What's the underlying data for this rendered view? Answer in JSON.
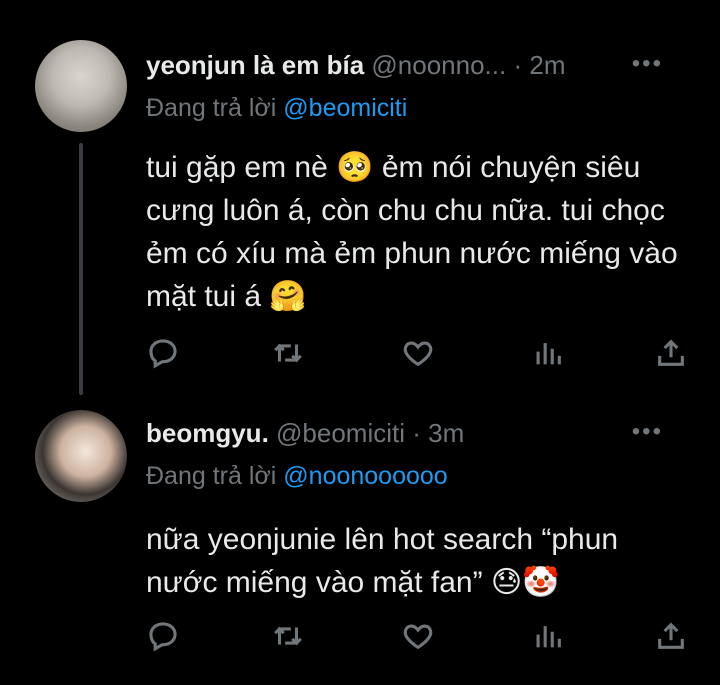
{
  "tweets": [
    {
      "display_name": "yeonjun là em bía",
      "handle": "@noonno...",
      "separator": "·",
      "time": "2m",
      "more": "•••",
      "reply_prefix": "Đang trả lời ",
      "reply_to": "@beomiciti",
      "text_before": "tui gặp em nè ",
      "emoji_1": "🥺",
      "text_middle": " ẻm nói chuyện siêu cưng luôn á, còn chu chu nữa. tui chọc ẻm có xíu mà ẻm phun nước miếng vào mặt tui á ",
      "emoji_2": "🤗"
    },
    {
      "display_name": "beomgyu.",
      "handle": "@beomiciti",
      "separator": "·",
      "time": "3m",
      "more": "•••",
      "reply_prefix": "Đang trả lời ",
      "reply_to": "@noonoooooo",
      "text_before": "nữa yeonjunie lên hot search “phun nước miếng vào mặt fan” ",
      "emoji_1": "😓",
      "emoji_2": "🤡"
    }
  ],
  "icons": {
    "reply": "reply-icon",
    "retweet": "retweet-icon",
    "like": "like-icon",
    "stats": "stats-icon",
    "share": "share-icon"
  },
  "colors": {
    "background": "#000000",
    "text": "#e7e9ea",
    "muted": "#71767b",
    "link": "#1d9bf0"
  }
}
